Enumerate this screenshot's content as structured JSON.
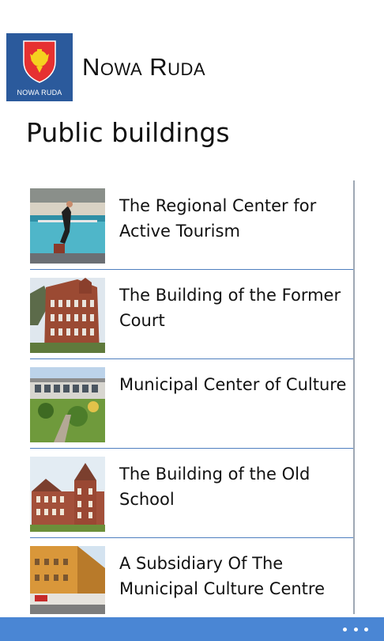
{
  "app": {
    "title": "Nowa Ruda",
    "logo_caption": "NOWA RUDA",
    "logo_icon": "coat-of-arms-icon"
  },
  "page": {
    "title": "Public buildings"
  },
  "list": {
    "items": [
      {
        "label": "The Regional Center for Active Tourism",
        "thumb_icon": "swimming-pool-photo"
      },
      {
        "label": "The Building of the Former Court",
        "thumb_icon": "brick-building-photo"
      },
      {
        "label": "Municipal Center of Culture",
        "thumb_icon": "culture-center-photo"
      },
      {
        "label": "The Building of the Old School",
        "thumb_icon": "old-school-photo"
      },
      {
        "label": "A Subsidiary Of The Municipal Culture Centre",
        "thumb_icon": "subsidiary-building-photo"
      }
    ]
  },
  "app_bar": {
    "more_icon": "ellipsis-icon"
  },
  "colors": {
    "logo_background": "#2b5a9c",
    "accent": "#4a86d4",
    "divider": "#4f7fbf"
  }
}
